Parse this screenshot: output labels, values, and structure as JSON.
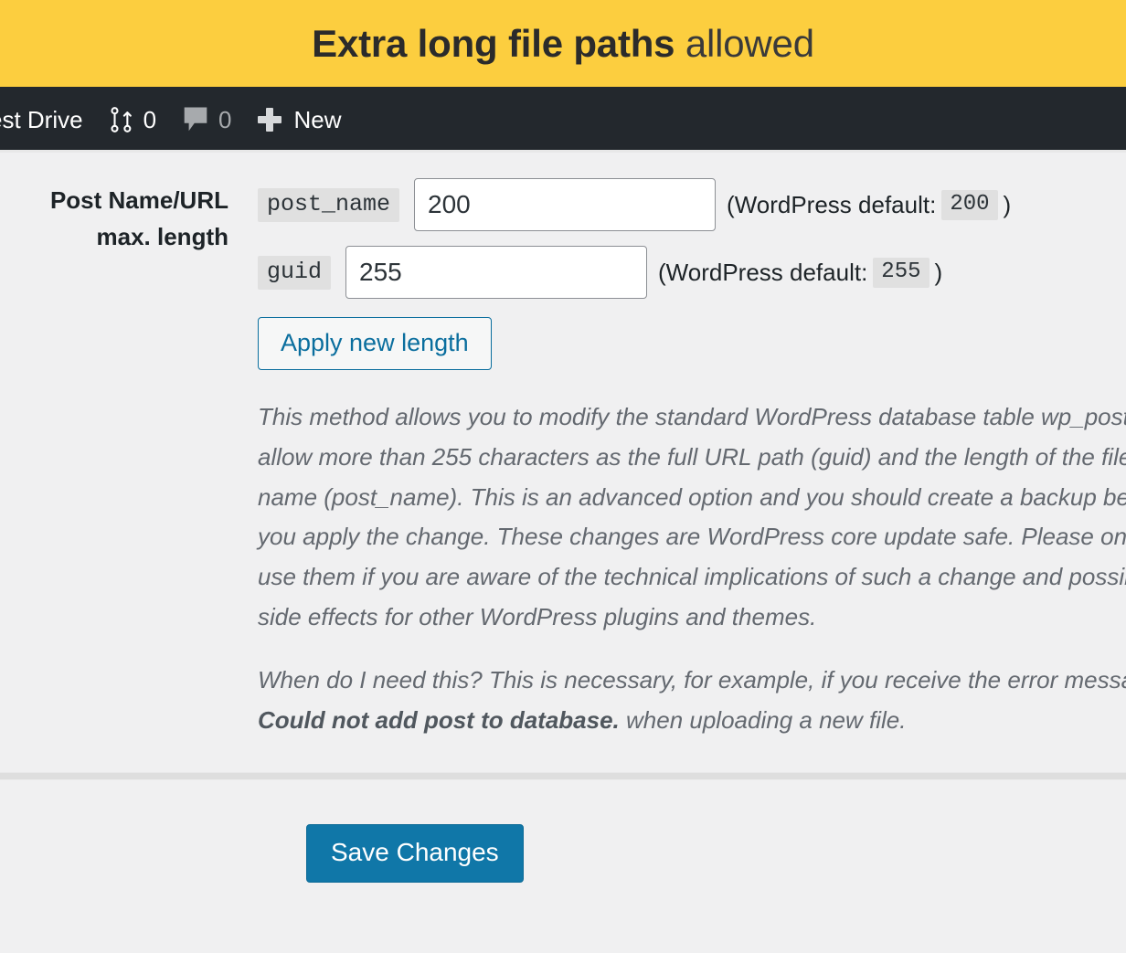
{
  "notice": {
    "title_strong": "Extra long file paths",
    "title_light": "allowed"
  },
  "adminbar": {
    "site_name": "est Drive",
    "updates_icon": "updates-icon",
    "updates_count": "0",
    "comments_icon": "comment-bubble-icon",
    "comments_count": "0",
    "new_icon": "plus-icon",
    "new_label": "New"
  },
  "settings": {
    "row_label_line1": "Post Name/URL",
    "row_label_line2": "max. length",
    "post_name": {
      "code_label": "post_name",
      "value": "200",
      "default_prefix": "(WordPress default:",
      "default_value": "200",
      "default_suffix": ")"
    },
    "guid": {
      "code_label": "guid",
      "value": "255",
      "default_prefix": "(WordPress default:",
      "default_value": "255",
      "default_suffix": ")"
    },
    "apply_button": "Apply new length",
    "description_1_a": "This method allows you to modify the standard WordPress database table wp_posts to allow more than 255 characters as the full URL path (guid) and the length of the file name (post_name). This is an advanced option and you should create a backup before you apply the change. These changes are WordPress core update safe. Please only use them if you are aware of the technical implications of such a change and possible side effects for other WordPress plugins and themes.",
    "description_2_a": "When do I need this? This is necessary, for example, if you receive the error message ",
    "description_2_bold": "Could not add post to database.",
    "description_2_b": " when uploading a new file."
  },
  "submit": {
    "save_label": "Save Changes"
  },
  "colors": {
    "notice_bg": "#fcce3f",
    "adminbar_bg": "#23282d",
    "page_bg": "#f0f0f1",
    "primary_button": "#1077a8",
    "secondary_border": "#0a6e9e",
    "code_bg": "#e0e0e0",
    "description_text": "#646970"
  }
}
